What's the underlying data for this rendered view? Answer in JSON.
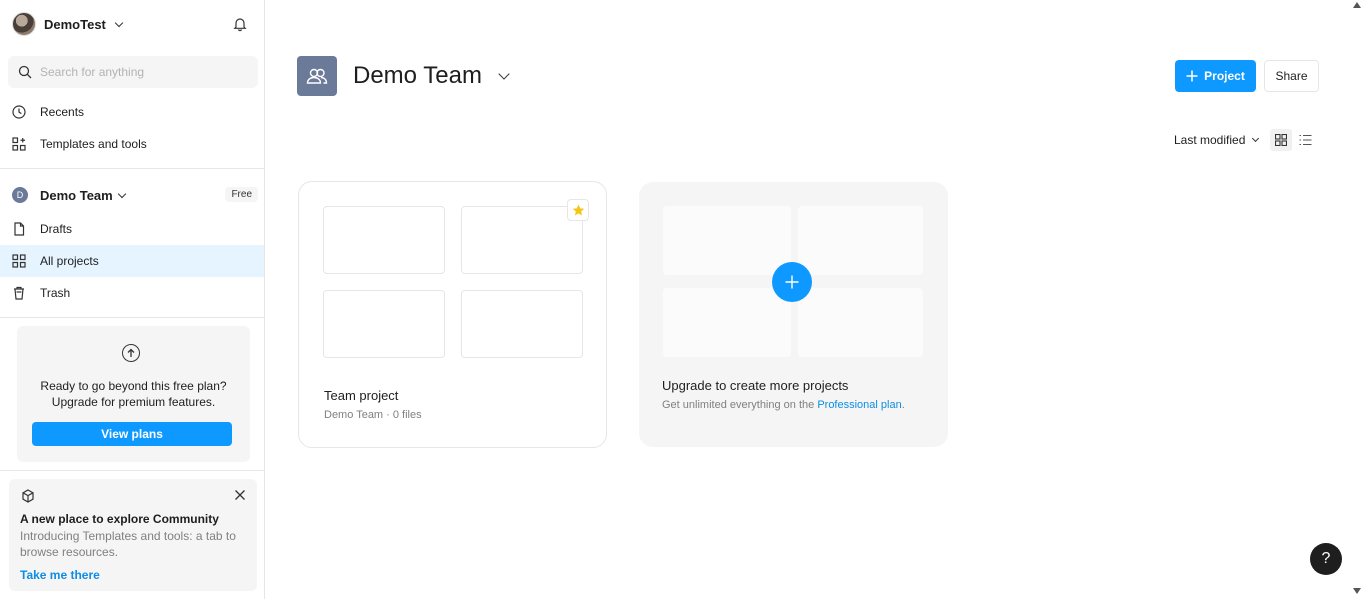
{
  "account": {
    "name": "DemoTest"
  },
  "search": {
    "placeholder": "Search for anything"
  },
  "nav": {
    "recents": "Recents",
    "templates": "Templates and tools"
  },
  "team": {
    "initial": "D",
    "name": "Demo Team",
    "plan_badge": "Free",
    "items": [
      {
        "label": "Drafts",
        "icon": "file-icon"
      },
      {
        "label": "All projects",
        "icon": "grid-icon",
        "active": true
      },
      {
        "label": "Trash",
        "icon": "trash-icon"
      }
    ]
  },
  "upgrade_card": {
    "line1": "Ready to go beyond this free plan?",
    "line2": "Upgrade for premium features.",
    "button": "View plans"
  },
  "community": {
    "title": "A new place to explore Community",
    "body": "Introducing Templates and tools: a tab to browse resources.",
    "link": "Take me there"
  },
  "main": {
    "title": "Demo Team",
    "new_project_button": "Project",
    "share_button": "Share",
    "sort_label": "Last modified",
    "view_mode": "grid"
  },
  "projects": [
    {
      "title": "Team project",
      "meta": "Demo Team · 0 files",
      "starred": true
    }
  ],
  "upgrade_projects": {
    "title": "Upgrade to create more projects",
    "text": "Get unlimited everything on the ",
    "link": "Professional plan",
    "suffix": "."
  },
  "help": {
    "label": "?"
  },
  "colors": {
    "accent": "#0d99ff",
    "team_avatar": "#6b7a99",
    "active_nav": "#e5f4ff",
    "star": "#f5c518"
  }
}
